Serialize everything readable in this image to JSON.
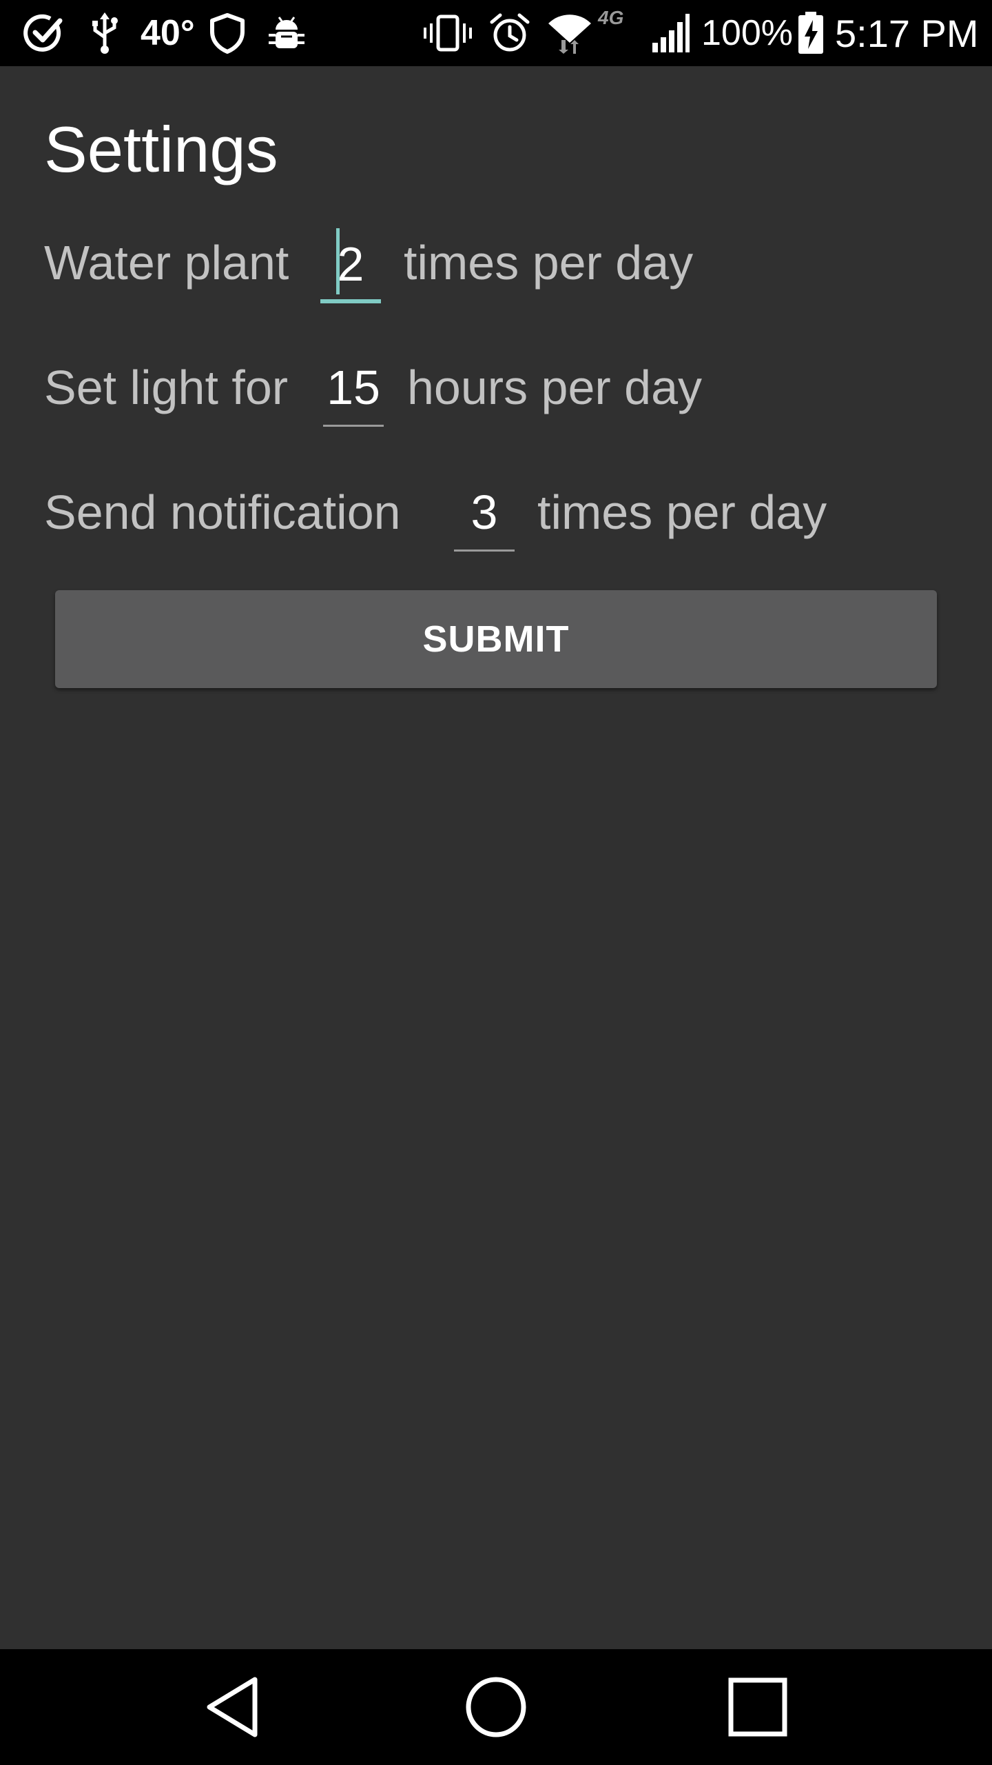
{
  "status_bar": {
    "temperature": "40°",
    "network": "4G",
    "battery_percent": "100%",
    "time": "5:17 PM",
    "icons_left": [
      "check-circle-icon",
      "usb-icon",
      "shield-icon",
      "android-bug-icon"
    ],
    "icons_right": [
      "vibrate-icon",
      "alarm-icon",
      "wifi-icon",
      "signal-icon",
      "battery-charging-icon"
    ]
  },
  "page": {
    "title": "Settings"
  },
  "settings": [
    {
      "prefix": "Water plant",
      "value": "2",
      "suffix": "times per day",
      "focused": true
    },
    {
      "prefix": "Set light for",
      "value": "15",
      "suffix": "hours per day",
      "focused": false
    },
    {
      "prefix": "Send notification",
      "value": "3",
      "suffix": "times per day",
      "focused": false
    }
  ],
  "submit": {
    "label": "SUBMIT"
  },
  "nav_bar": {
    "buttons": [
      "back-icon",
      "home-icon",
      "recents-icon"
    ]
  },
  "colors": {
    "background": "#303030",
    "accent": "#80cbc4",
    "button": "#5a5a5b"
  }
}
